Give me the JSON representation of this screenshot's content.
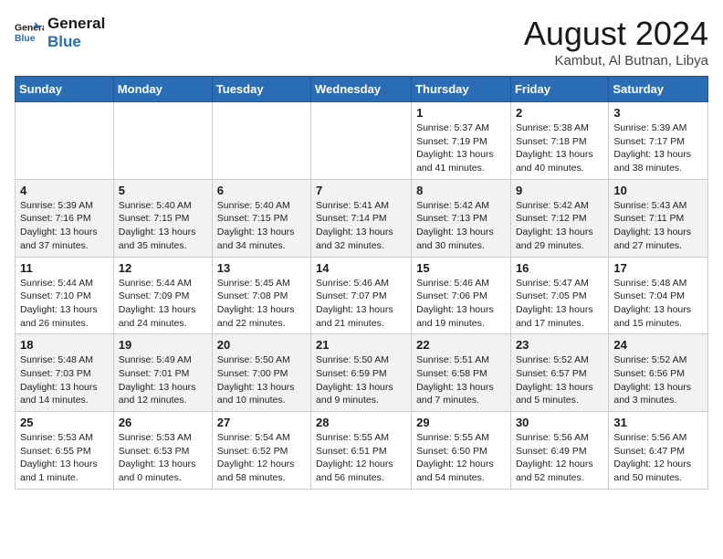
{
  "logo": {
    "line1": "General",
    "line2": "Blue"
  },
  "title": "August 2024",
  "location": "Kambut, Al Butnan, Libya",
  "weekdays": [
    "Sunday",
    "Monday",
    "Tuesday",
    "Wednesday",
    "Thursday",
    "Friday",
    "Saturday"
  ],
  "weeks": [
    [
      {
        "day": "",
        "info": ""
      },
      {
        "day": "",
        "info": ""
      },
      {
        "day": "",
        "info": ""
      },
      {
        "day": "",
        "info": ""
      },
      {
        "day": "1",
        "info": "Sunrise: 5:37 AM\nSunset: 7:19 PM\nDaylight: 13 hours\nand 41 minutes."
      },
      {
        "day": "2",
        "info": "Sunrise: 5:38 AM\nSunset: 7:18 PM\nDaylight: 13 hours\nand 40 minutes."
      },
      {
        "day": "3",
        "info": "Sunrise: 5:39 AM\nSunset: 7:17 PM\nDaylight: 13 hours\nand 38 minutes."
      }
    ],
    [
      {
        "day": "4",
        "info": "Sunrise: 5:39 AM\nSunset: 7:16 PM\nDaylight: 13 hours\nand 37 minutes."
      },
      {
        "day": "5",
        "info": "Sunrise: 5:40 AM\nSunset: 7:15 PM\nDaylight: 13 hours\nand 35 minutes."
      },
      {
        "day": "6",
        "info": "Sunrise: 5:40 AM\nSunset: 7:15 PM\nDaylight: 13 hours\nand 34 minutes."
      },
      {
        "day": "7",
        "info": "Sunrise: 5:41 AM\nSunset: 7:14 PM\nDaylight: 13 hours\nand 32 minutes."
      },
      {
        "day": "8",
        "info": "Sunrise: 5:42 AM\nSunset: 7:13 PM\nDaylight: 13 hours\nand 30 minutes."
      },
      {
        "day": "9",
        "info": "Sunrise: 5:42 AM\nSunset: 7:12 PM\nDaylight: 13 hours\nand 29 minutes."
      },
      {
        "day": "10",
        "info": "Sunrise: 5:43 AM\nSunset: 7:11 PM\nDaylight: 13 hours\nand 27 minutes."
      }
    ],
    [
      {
        "day": "11",
        "info": "Sunrise: 5:44 AM\nSunset: 7:10 PM\nDaylight: 13 hours\nand 26 minutes."
      },
      {
        "day": "12",
        "info": "Sunrise: 5:44 AM\nSunset: 7:09 PM\nDaylight: 13 hours\nand 24 minutes."
      },
      {
        "day": "13",
        "info": "Sunrise: 5:45 AM\nSunset: 7:08 PM\nDaylight: 13 hours\nand 22 minutes."
      },
      {
        "day": "14",
        "info": "Sunrise: 5:46 AM\nSunset: 7:07 PM\nDaylight: 13 hours\nand 21 minutes."
      },
      {
        "day": "15",
        "info": "Sunrise: 5:46 AM\nSunset: 7:06 PM\nDaylight: 13 hours\nand 19 minutes."
      },
      {
        "day": "16",
        "info": "Sunrise: 5:47 AM\nSunset: 7:05 PM\nDaylight: 13 hours\nand 17 minutes."
      },
      {
        "day": "17",
        "info": "Sunrise: 5:48 AM\nSunset: 7:04 PM\nDaylight: 13 hours\nand 15 minutes."
      }
    ],
    [
      {
        "day": "18",
        "info": "Sunrise: 5:48 AM\nSunset: 7:03 PM\nDaylight: 13 hours\nand 14 minutes."
      },
      {
        "day": "19",
        "info": "Sunrise: 5:49 AM\nSunset: 7:01 PM\nDaylight: 13 hours\nand 12 minutes."
      },
      {
        "day": "20",
        "info": "Sunrise: 5:50 AM\nSunset: 7:00 PM\nDaylight: 13 hours\nand 10 minutes."
      },
      {
        "day": "21",
        "info": "Sunrise: 5:50 AM\nSunset: 6:59 PM\nDaylight: 13 hours\nand 9 minutes."
      },
      {
        "day": "22",
        "info": "Sunrise: 5:51 AM\nSunset: 6:58 PM\nDaylight: 13 hours\nand 7 minutes."
      },
      {
        "day": "23",
        "info": "Sunrise: 5:52 AM\nSunset: 6:57 PM\nDaylight: 13 hours\nand 5 minutes."
      },
      {
        "day": "24",
        "info": "Sunrise: 5:52 AM\nSunset: 6:56 PM\nDaylight: 13 hours\nand 3 minutes."
      }
    ],
    [
      {
        "day": "25",
        "info": "Sunrise: 5:53 AM\nSunset: 6:55 PM\nDaylight: 13 hours\nand 1 minute."
      },
      {
        "day": "26",
        "info": "Sunrise: 5:53 AM\nSunset: 6:53 PM\nDaylight: 13 hours\nand 0 minutes."
      },
      {
        "day": "27",
        "info": "Sunrise: 5:54 AM\nSunset: 6:52 PM\nDaylight: 12 hours\nand 58 minutes."
      },
      {
        "day": "28",
        "info": "Sunrise: 5:55 AM\nSunset: 6:51 PM\nDaylight: 12 hours\nand 56 minutes."
      },
      {
        "day": "29",
        "info": "Sunrise: 5:55 AM\nSunset: 6:50 PM\nDaylight: 12 hours\nand 54 minutes."
      },
      {
        "day": "30",
        "info": "Sunrise: 5:56 AM\nSunset: 6:49 PM\nDaylight: 12 hours\nand 52 minutes."
      },
      {
        "day": "31",
        "info": "Sunrise: 5:56 AM\nSunset: 6:47 PM\nDaylight: 12 hours\nand 50 minutes."
      }
    ]
  ]
}
